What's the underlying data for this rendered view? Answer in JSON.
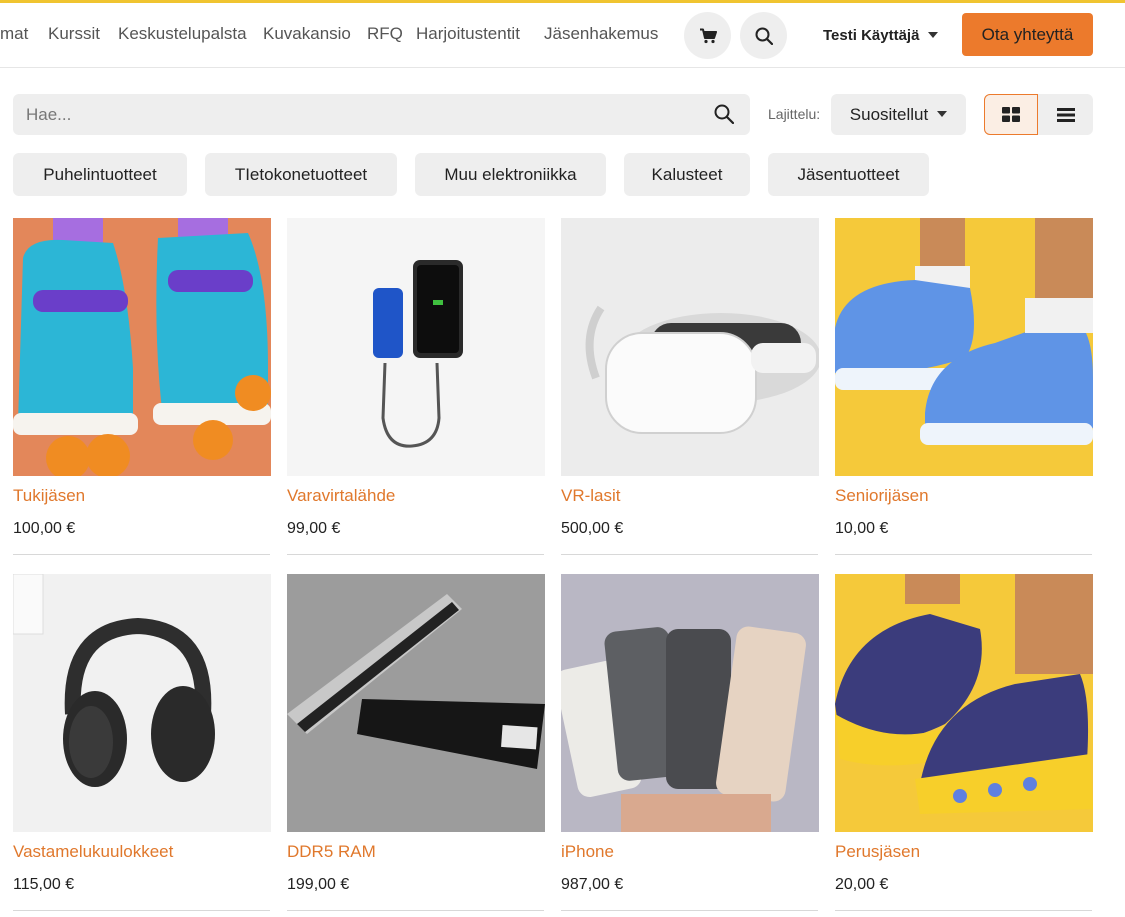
{
  "nav": {
    "links": [
      "mat",
      "Kurssit",
      "Keskustelupalsta",
      "Kuvakansio",
      "RFQ",
      "Harjoitustentit",
      "Jäsenhakemus"
    ],
    "user": "Testi Käyttäjä",
    "contact": "Ota yhteyttä"
  },
  "search": {
    "placeholder": "Hae..."
  },
  "sort": {
    "label": "Lajittelu:",
    "value": "Suositellut"
  },
  "categories": [
    "Puhelintuotteet",
    "TIetokonetuotteet",
    "Muu elektroniikka",
    "Kalusteet",
    "Jäsentuotteet"
  ],
  "products": [
    {
      "name": "Tukijäsen",
      "price": "100,00 €"
    },
    {
      "name": "Varavirtalähde",
      "price": "99,00 €"
    },
    {
      "name": "VR-lasit",
      "price": "500,00 €"
    },
    {
      "name": "Seniorijäsen",
      "price": "10,00 €"
    },
    {
      "name": "Vastamelukuulokkeet",
      "price": "115,00 €"
    },
    {
      "name": "DDR5 RAM",
      "price": "199,00 €"
    },
    {
      "name": "iPhone",
      "price": "987,00 €"
    },
    {
      "name": "Perusjäsen",
      "price": "20,00 €"
    }
  ],
  "colors": {
    "accent": "#ec7a2c",
    "topline": "#f0c430",
    "link": "#e0782c",
    "chip": "#eeeeee"
  },
  "icons": [
    "cart-icon",
    "search-icon",
    "grid-view-icon",
    "list-view-icon",
    "caret-down-icon"
  ]
}
